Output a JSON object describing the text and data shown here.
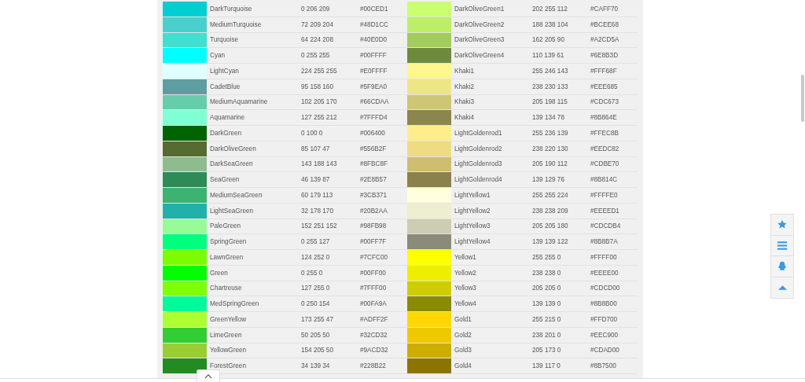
{
  "color_tables": [
    {
      "rows": [
        {
          "name": "DarkTurquoise",
          "rgb": "0 206 209",
          "hex": "#00CED1",
          "color": "#00ced1"
        },
        {
          "name": "MediumTurquoise",
          "rgb": "72 209 204",
          "hex": "#48D1CC",
          "color": "#48d1cc"
        },
        {
          "name": "Turquoise",
          "rgb": "64 224 208",
          "hex": "#40E0D0",
          "color": "#40e0d0"
        },
        {
          "name": "Cyan",
          "rgb": "0 255 255",
          "hex": "#00FFFF",
          "color": "#00ffff"
        },
        {
          "name": "LightCyan",
          "rgb": "224 255 255",
          "hex": "#E0FFFF",
          "color": "#e0ffff"
        },
        {
          "name": "CadetBlue",
          "rgb": "95 158 160",
          "hex": "#5F9EA0",
          "color": "#5f9ea0"
        },
        {
          "name": "MediumAquamarine",
          "rgb": "102 205 170",
          "hex": "#66CDAA",
          "color": "#66cdaa"
        },
        {
          "name": "Aquamarine",
          "rgb": "127 255 212",
          "hex": "#7FFFD4",
          "color": "#7fffd4"
        },
        {
          "name": "DarkGreen",
          "rgb": "0 100 0",
          "hex": "#006400",
          "color": "#006400"
        },
        {
          "name": "DarkOliveGreen",
          "rgb": "85 107 47",
          "hex": "#556B2F",
          "color": "#556b2f"
        },
        {
          "name": "DarkSeaGreen",
          "rgb": "143 188 143",
          "hex": "#8FBC8F",
          "color": "#8fbc8f"
        },
        {
          "name": "SeaGreen",
          "rgb": "46 139 87",
          "hex": "#2E8B57",
          "color": "#2e8b57"
        },
        {
          "name": "MediumSeaGreen",
          "rgb": "60 179 113",
          "hex": "#3CB371",
          "color": "#3cb371"
        },
        {
          "name": "LightSeaGreen",
          "rgb": "32 178 170",
          "hex": "#20B2AA",
          "color": "#20b2aa"
        },
        {
          "name": "PaleGreen",
          "rgb": "152 251 152",
          "hex": "#98FB98",
          "color": "#98fb98"
        },
        {
          "name": "SpringGreen",
          "rgb": "0 255 127",
          "hex": "#00FF7F",
          "color": "#00ff7f"
        },
        {
          "name": "LawnGreen",
          "rgb": "124 252 0",
          "hex": "#7CFC00",
          "color": "#7cfc00"
        },
        {
          "name": "Green",
          "rgb": "0 255 0",
          "hex": "#00FF00",
          "color": "#00ff00"
        },
        {
          "name": "Chartreuse",
          "rgb": "127 255 0",
          "hex": "#7FFF00",
          "color": "#7fff00"
        },
        {
          "name": "MedSpringGreen",
          "rgb": "0 250 154",
          "hex": "#00FA9A",
          "color": "#00fa9a"
        },
        {
          "name": "GreenYellow",
          "rgb": "173 255 47",
          "hex": "#ADFF2F",
          "color": "#adff2f"
        },
        {
          "name": "LimeGreen",
          "rgb": "50 205 50",
          "hex": "#32CD32",
          "color": "#32cd32"
        },
        {
          "name": "YellowGreen",
          "rgb": "154 205 50",
          "hex": "#9ACD32",
          "color": "#9acd32"
        },
        {
          "name": "ForestGreen",
          "rgb": "34 139 34",
          "hex": "#228B22",
          "color": "#228b22"
        }
      ]
    },
    {
      "rows": [
        {
          "name": "DarkOliveGreen1",
          "rgb": "202 255 112",
          "hex": "#CAFF70",
          "color": "#caff70"
        },
        {
          "name": "DarkOliveGreen2",
          "rgb": "188 238 104",
          "hex": "#BCEE68",
          "color": "#bcee68"
        },
        {
          "name": "DarkOliveGreen3",
          "rgb": "162 205 90",
          "hex": "#A2CD5A",
          "color": "#a2cd5a"
        },
        {
          "name": "DarkOliveGreen4",
          "rgb": "110 139 61",
          "hex": "#6E8B3D",
          "color": "#6e8b3d"
        },
        {
          "name": "Khaki1",
          "rgb": "255 246 143",
          "hex": "#FFF68F",
          "color": "#fff68f"
        },
        {
          "name": "Khaki2",
          "rgb": "238 230 133",
          "hex": "#EEE685",
          "color": "#eee685"
        },
        {
          "name": "Khaki3",
          "rgb": "205 198 115",
          "hex": "#CDC673",
          "color": "#cdc673"
        },
        {
          "name": "Khaki4",
          "rgb": "139 134 78",
          "hex": "#8B864E",
          "color": "#8b864e"
        },
        {
          "name": "LightGoldenrod1",
          "rgb": "255 236 139",
          "hex": "#FFEC8B",
          "color": "#ffec8b"
        },
        {
          "name": "LightGoldenrod2",
          "rgb": "238 220 130",
          "hex": "#EEDC82",
          "color": "#eedc82"
        },
        {
          "name": "LightGoldenrod3",
          "rgb": "205 190 112",
          "hex": "#CDBE70",
          "color": "#cdbe70"
        },
        {
          "name": "LightGoldenrod4",
          "rgb": "139 129 76",
          "hex": "#8B814C",
          "color": "#8b814c"
        },
        {
          "name": "LightYellow1",
          "rgb": "255 255 224",
          "hex": "#FFFFE0",
          "color": "#ffffe0"
        },
        {
          "name": "LightYellow2",
          "rgb": "238 238 209",
          "hex": "#EEEED1",
          "color": "#eeeed1"
        },
        {
          "name": "LightYellow3",
          "rgb": "205 205 180",
          "hex": "#CDCDB4",
          "color": "#cdcdb4"
        },
        {
          "name": "LightYellow4",
          "rgb": "139 139 122",
          "hex": "#8B8B7A",
          "color": "#8b8b7a"
        },
        {
          "name": "Yellow1",
          "rgb": "255 255 0",
          "hex": "#FFFF00",
          "color": "#ffff00"
        },
        {
          "name": "Yellow2",
          "rgb": "238 238 0",
          "hex": "#EEEE00",
          "color": "#eeee00"
        },
        {
          "name": "Yellow3",
          "rgb": "205 205 0",
          "hex": "#CDCD00",
          "color": "#cdcd00"
        },
        {
          "name": "Yellow4",
          "rgb": "139 139 0",
          "hex": "#8B8B00",
          "color": "#8b8b00"
        },
        {
          "name": "Gold1",
          "rgb": "255 215 0",
          "hex": "#FFD700",
          "color": "#ffd700"
        },
        {
          "name": "Gold2",
          "rgb": "238 201 0",
          "hex": "#EEC900",
          "color": "#eec900"
        },
        {
          "name": "Gold3",
          "rgb": "205 173 0",
          "hex": "#CDAD00",
          "color": "#cdad00"
        },
        {
          "name": "Gold4",
          "rgb": "139 117 0",
          "hex": "#8B7500",
          "color": "#8b7500"
        }
      ]
    }
  ]
}
